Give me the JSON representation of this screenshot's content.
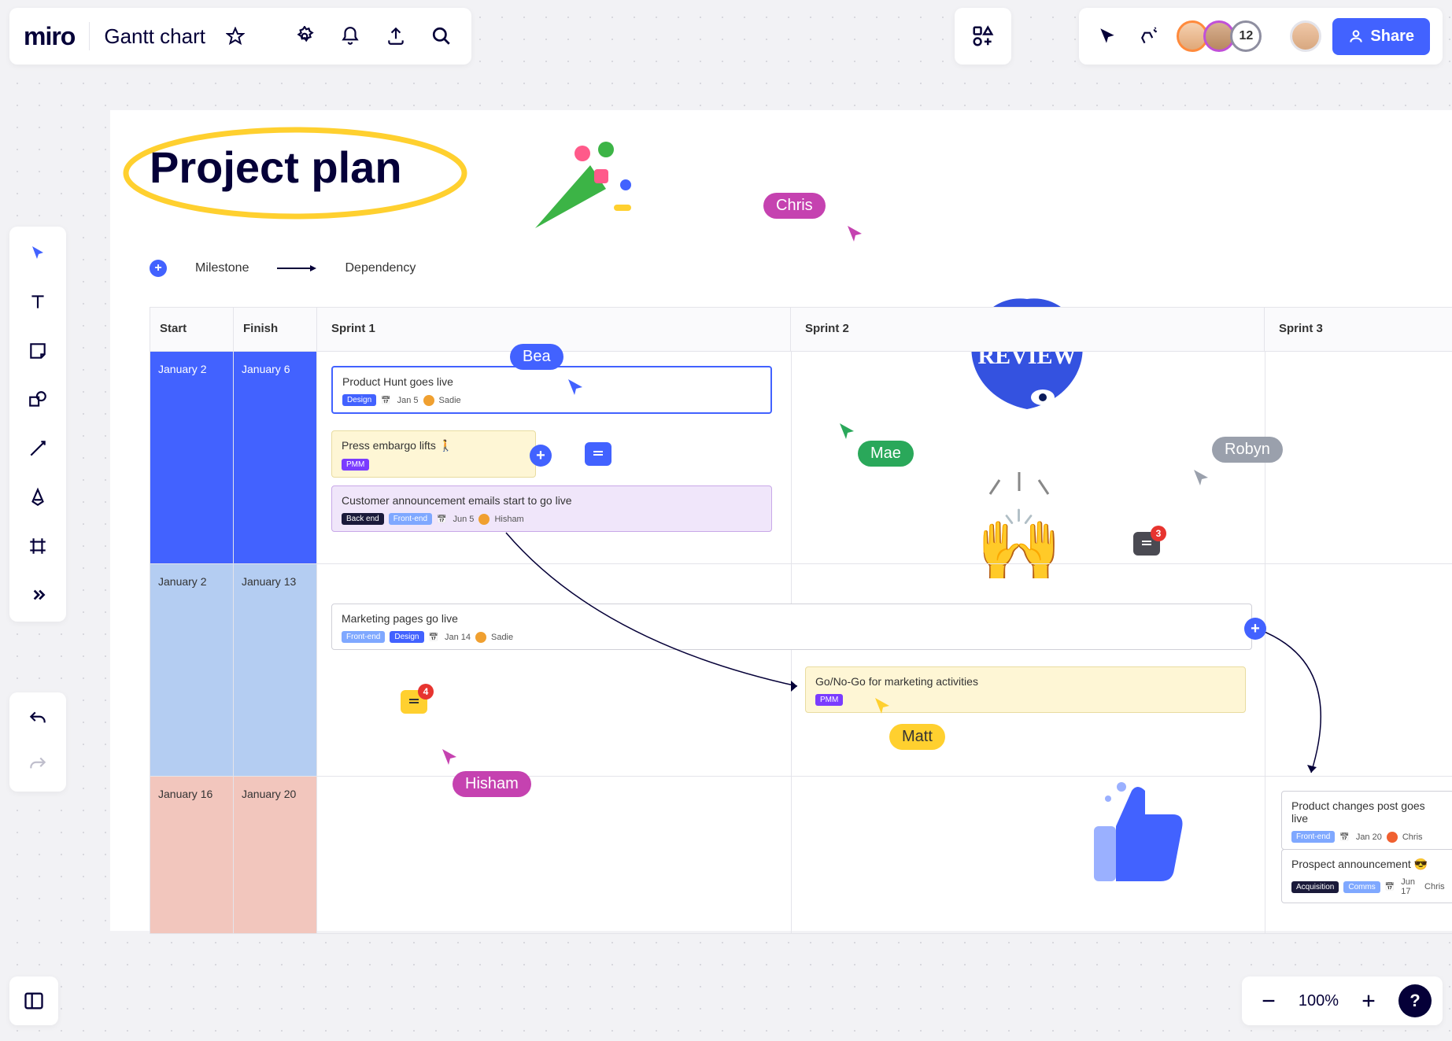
{
  "header": {
    "logo": "miro",
    "board_title": "Gantt chart",
    "share_label": "Share",
    "avatar_count": "12"
  },
  "canvas": {
    "title": "Project plan",
    "legend": {
      "milestone": "Milestone",
      "dependency": "Dependency"
    },
    "review_sticker": "REVIEW"
  },
  "gantt": {
    "headers": {
      "start": "Start",
      "finish": "Finish",
      "sprint1": "Sprint 1",
      "sprint2": "Sprint 2",
      "sprint3": "Sprint 3"
    },
    "rows": [
      {
        "start": "January 2",
        "finish": "January 6"
      },
      {
        "start": "January 2",
        "finish": "January 13"
      },
      {
        "start": "January 16",
        "finish": "January 20"
      }
    ]
  },
  "cards": {
    "product_hunt": {
      "title": "Product Hunt goes live",
      "tag": "Design",
      "date": "Jan 5",
      "owner": "Sadie"
    },
    "press_embargo": {
      "title": "Press embargo lifts 🚶",
      "tag": "PMM"
    },
    "customer_emails": {
      "title": "Customer announcement emails start to go live",
      "tag1": "Back end",
      "tag2": "Front-end",
      "date": "Jun 5",
      "owner": "Hisham"
    },
    "marketing_pages": {
      "title": "Marketing pages go live",
      "tag1": "Front-end",
      "tag2": "Design",
      "date": "Jan 14",
      "owner": "Sadie"
    },
    "go_nogo": {
      "title": "Go/No-Go for marketing activities",
      "tag": "PMM"
    },
    "product_changes": {
      "title": "Product changes post goes live",
      "tag": "Front-end",
      "date": "Jan 20",
      "owner": "Chris"
    },
    "prospect": {
      "title": "Prospect announcement 😎",
      "tag1": "Acquisition",
      "tag2": "Comms",
      "date": "Jun 17",
      "owner": "Chris"
    }
  },
  "cursors": {
    "chris": "Chris",
    "bea": "Bea",
    "mae": "Mae",
    "robyn": "Robyn",
    "hisham": "Hisham",
    "matt": "Matt"
  },
  "comments": {
    "c1": "4",
    "c2": "3"
  },
  "zoom": {
    "level": "100%"
  }
}
